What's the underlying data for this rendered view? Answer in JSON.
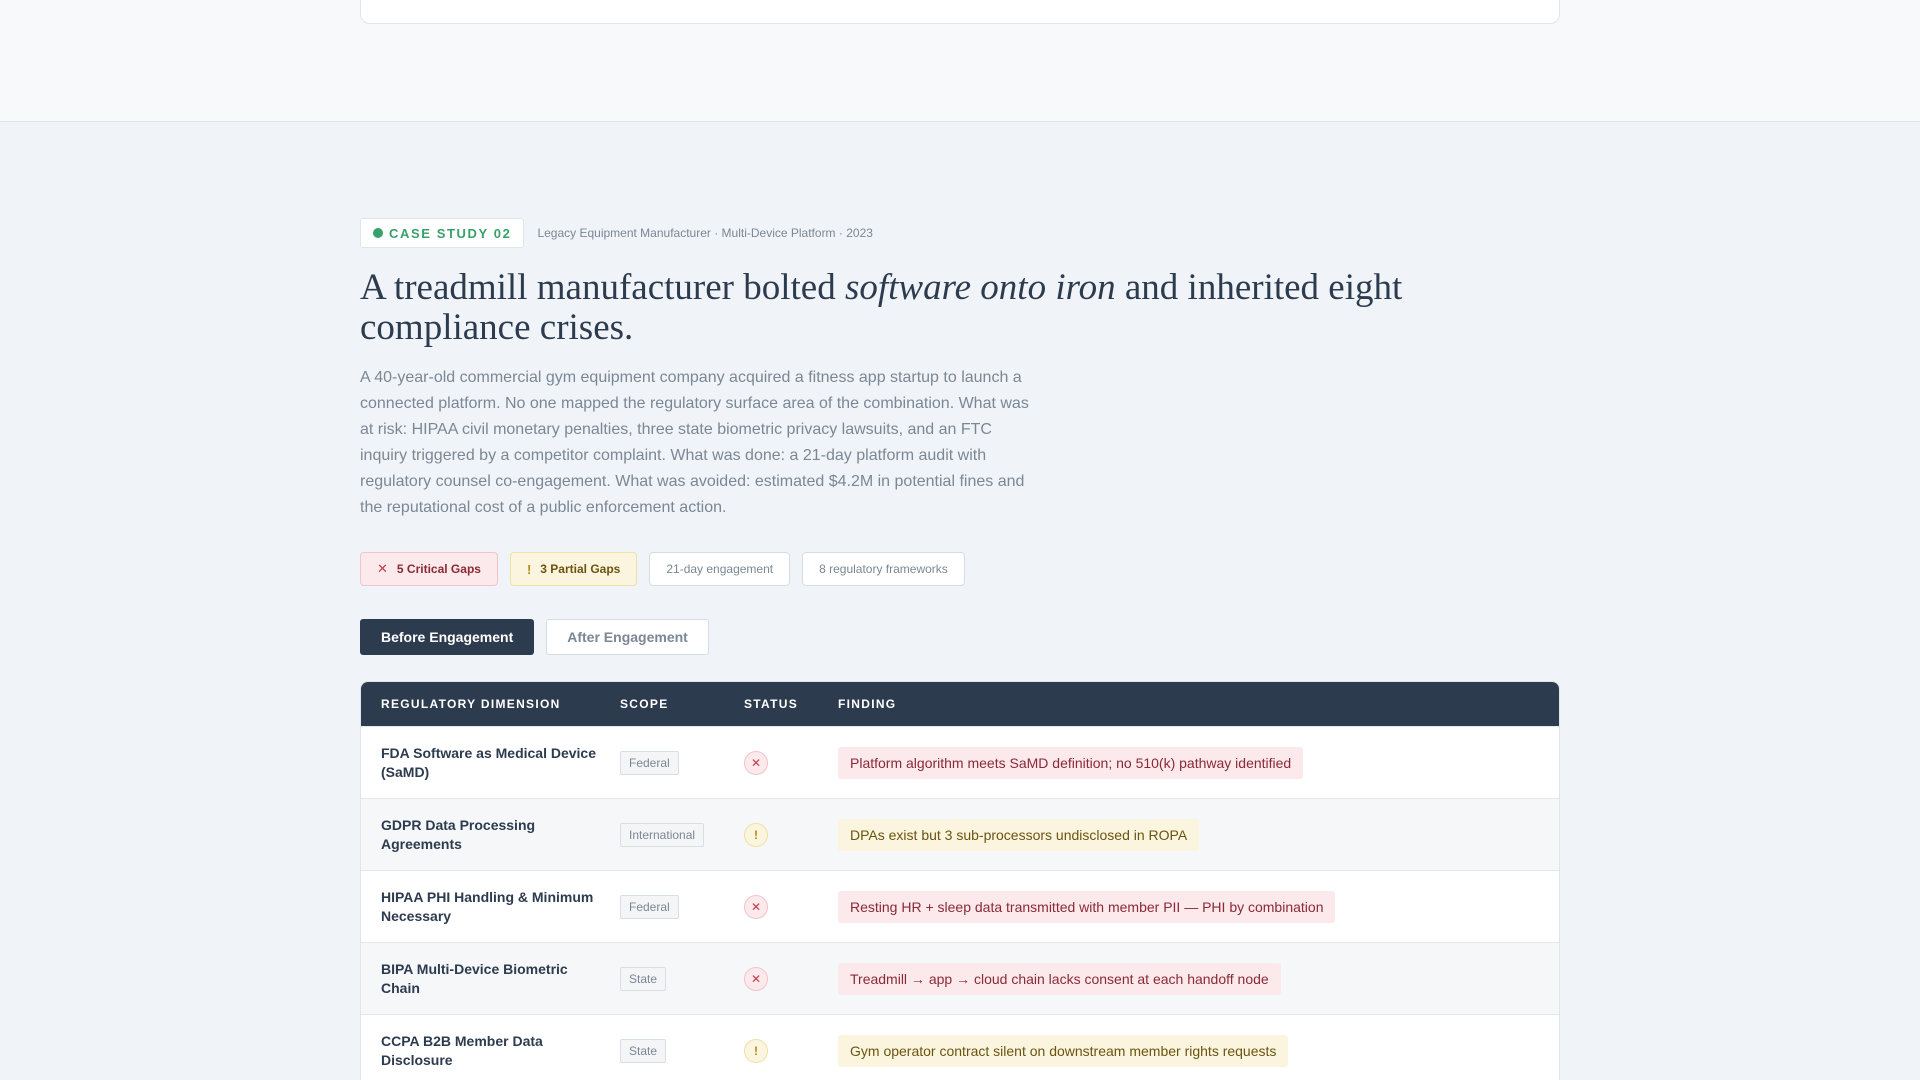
{
  "case_study": {
    "badge_label": "CASE STUDY 02",
    "badge_color": "#38a169",
    "meta": "Legacy Equipment Manufacturer · Multi-Device Platform · 2023"
  },
  "headline": {
    "part1": "A treadmill manufacturer bolted ",
    "emphasis": "software onto iron",
    "part2": " and inherited eight compliance crises."
  },
  "lede": "A 40-year-old commercial gym equipment company acquired a fitness app startup to launch a connected platform. No one mapped the regulatory surface area of the combination. What was at risk: HIPAA civil monetary penalties, three state biometric privacy lawsuits, and an FTC inquiry triggered by a competitor complaint. What was done: a 21-day platform audit with regulatory counsel co-engagement. What was avoided: estimated $4.2M in potential fines and the reputational cost of a public enforcement action.",
  "pills": {
    "critical": {
      "icon": "✕",
      "label": "5 Critical Gaps"
    },
    "partial": {
      "icon": "!",
      "label": "3 Partial Gaps"
    },
    "duration": "21-day engagement",
    "frameworks": "8 regulatory frameworks"
  },
  "tabs": {
    "before": "Before Engagement",
    "after": "After Engagement"
  },
  "table": {
    "headers": {
      "dimension": "REGULATORY DIMENSION",
      "scope": "SCOPE",
      "status": "STATUS",
      "finding": "FINDING"
    },
    "rows": [
      {
        "dimension": "FDA Software as Medical Device (SaMD)",
        "scope": "Federal",
        "status": "critical",
        "status_icon": "✕",
        "finding": "Platform algorithm meets SaMD definition; no 510(k) pathway identified"
      },
      {
        "dimension": "GDPR Data Processing Agreements",
        "scope": "International",
        "status": "partial",
        "status_icon": "!",
        "finding": "DPAs exist but 3 sub-processors undisclosed in ROPA"
      },
      {
        "dimension": "HIPAA PHI Handling & Minimum Necessary",
        "scope": "Federal",
        "status": "critical",
        "status_icon": "✕",
        "finding": "Resting HR + sleep data transmitted with member PII — PHI by combination"
      },
      {
        "dimension": "BIPA Multi-Device Biometric Chain",
        "scope": "State",
        "status": "critical",
        "status_icon": "✕",
        "finding": "Treadmill → app → cloud chain lacks consent at each handoff node"
      },
      {
        "dimension": "CCPA B2B Member Data Disclosure",
        "scope": "State",
        "status": "partial",
        "status_icon": "!",
        "finding": "Gym operator contract silent on downstream member rights requests"
      }
    ]
  }
}
